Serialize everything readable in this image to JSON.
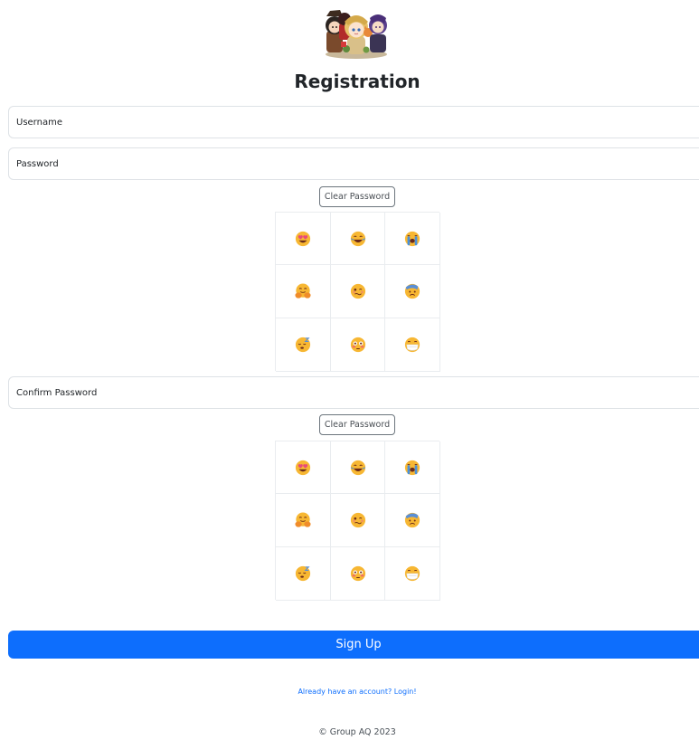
{
  "page": {
    "title": "Registration"
  },
  "username": {
    "placeholder": "Username",
    "value": ""
  },
  "password": {
    "placeholder": "Password",
    "value": "",
    "clear_label": "Clear Password",
    "emojis": [
      "smiling-face-with-heart-eyes-icon",
      "face-with-tears-of-joy-icon",
      "loudly-crying-face-icon",
      "smiling-face-with-open-hands-icon",
      "woozy-face-icon",
      "face-with-bandage-icon",
      "sleeping-face-icon",
      "flushed-face-icon",
      "face-with-medical-mask-icon"
    ]
  },
  "confirm_password": {
    "placeholder": "Confirm Password",
    "value": "",
    "clear_label": "Clear Password",
    "emojis": [
      "smiling-face-with-heart-eyes-icon",
      "face-with-tears-of-joy-icon",
      "loudly-crying-face-icon",
      "smiling-face-with-open-hands-icon",
      "woozy-face-icon",
      "face-with-bandage-icon",
      "sleeping-face-icon",
      "flushed-face-icon",
      "face-with-medical-mask-icon"
    ]
  },
  "actions": {
    "signup_label": "Sign Up",
    "login_link": "Already have an account? Login!"
  },
  "footer": {
    "text": "© Group AQ 2023"
  },
  "colors": {
    "primary": "#0d6efd",
    "emoji_yellow": "#f7b733",
    "emoji_orange": "#f08c2a",
    "blush_pink": "#e84a7a",
    "tear_blue": "#4a90d9"
  }
}
